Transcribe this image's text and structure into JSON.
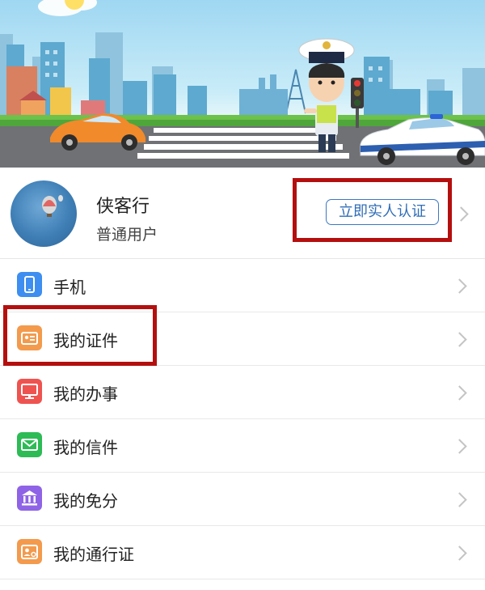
{
  "header": {
    "sky_color": "#a8dcf3",
    "road_color": "#6f7175",
    "illustration": "traffic-police-city-banner"
  },
  "profile": {
    "name": "侠客行",
    "role": "普通用户",
    "verify_label": "立即实人认证",
    "avatar_icon": "hot-air-balloon-photo",
    "accent_color": "#3a78c2",
    "highlight_color": "#b40f0f"
  },
  "menu": {
    "items": [
      {
        "label": "手机",
        "icon": "phone-icon",
        "color": "#3d8ef0"
      },
      {
        "label": "我的证件",
        "icon": "id-card-icon",
        "color": "#f39a4d"
      },
      {
        "label": "我的办事",
        "icon": "monitor-icon",
        "color": "#ef5350"
      },
      {
        "label": "我的信件",
        "icon": "envelope-icon",
        "color": "#2dbb56"
      },
      {
        "label": "我的免分",
        "icon": "bank-icon",
        "color": "#8f63e6"
      },
      {
        "label": "我的通行证",
        "icon": "pass-card-icon",
        "color": "#f39a4d"
      }
    ]
  }
}
